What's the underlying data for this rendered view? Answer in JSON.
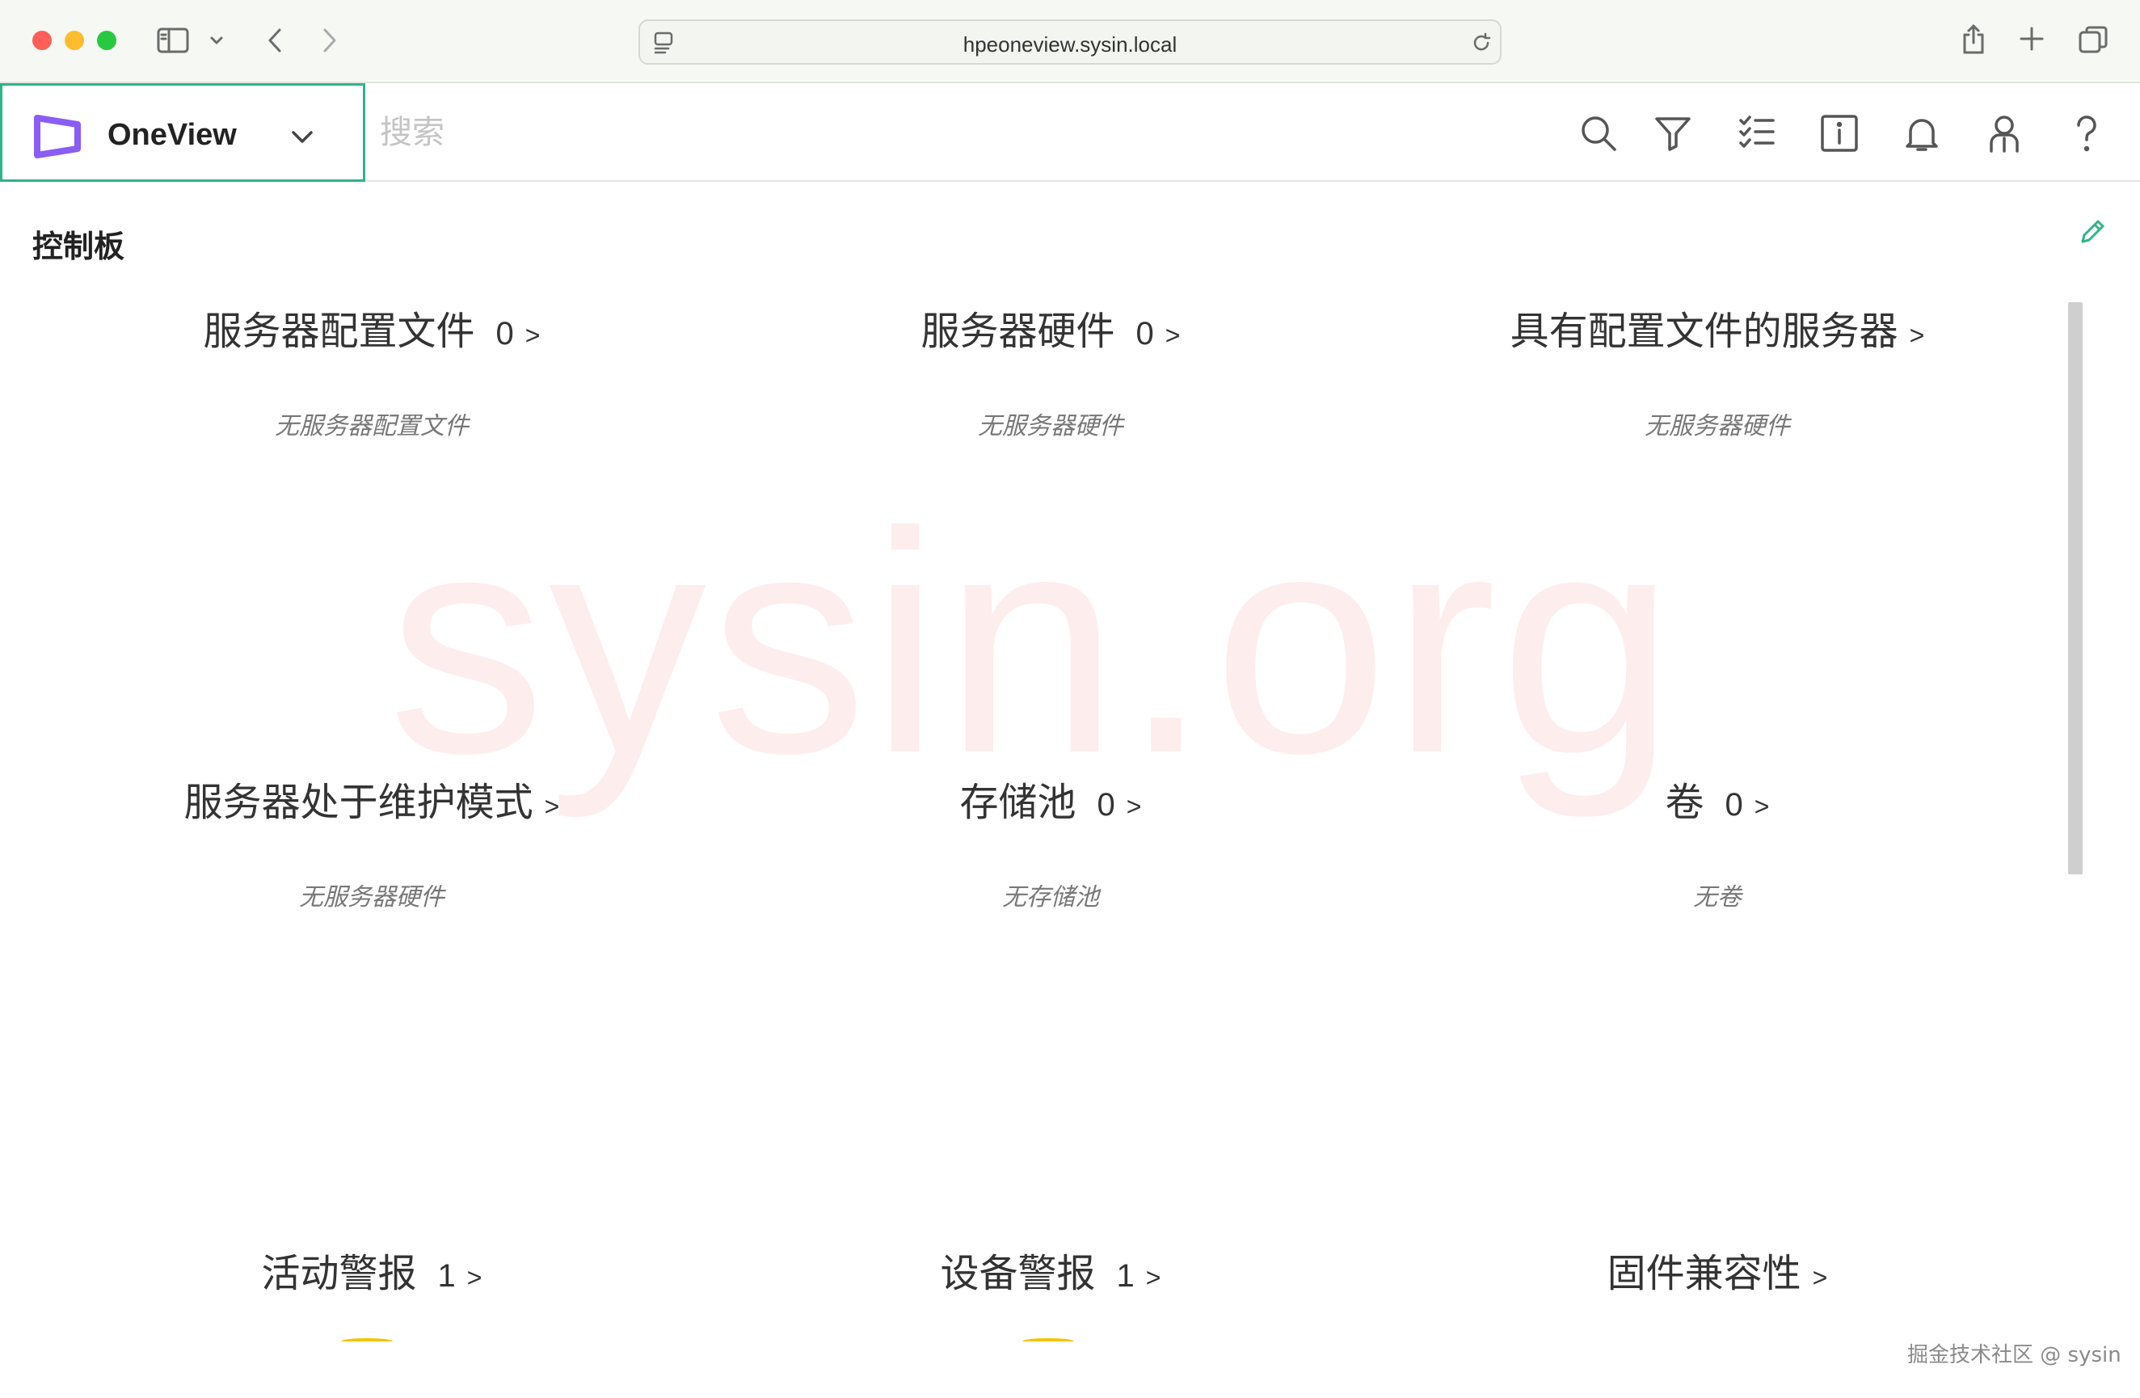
{
  "browser": {
    "url": "hpeoneview.sysin.local"
  },
  "app": {
    "name": "OneView",
    "search_placeholder": "搜索",
    "accent_color": "#2fb38a",
    "logo_color": "#8b5cf6"
  },
  "dashboard": {
    "title": "控制板",
    "panels": [
      {
        "name": "服务器配置文件",
        "count": "0",
        "arrow": ">",
        "empty": "无服务器配置文件"
      },
      {
        "name": "服务器硬件",
        "count": "0",
        "arrow": ">",
        "empty": "无服务器硬件"
      },
      {
        "name": "具有配置文件的服务器",
        "count": "",
        "arrow": ">",
        "empty": "无服务器硬件"
      },
      {
        "name": "服务器处于维护模式",
        "count": "",
        "arrow": ">",
        "empty": "无服务器硬件"
      },
      {
        "name": "存储池",
        "count": "0",
        "arrow": ">",
        "empty": "无存储池"
      },
      {
        "name": "卷",
        "count": "0",
        "arrow": ">",
        "empty": "无卷"
      },
      {
        "name": "活动警报",
        "count": "1",
        "arrow": ">",
        "empty": ""
      },
      {
        "name": "设备警报",
        "count": "1",
        "arrow": ">",
        "empty": ""
      },
      {
        "name": "固件兼容性",
        "count": "",
        "arrow": ">",
        "empty": ""
      }
    ]
  },
  "watermark": "sysin.org",
  "credit": "掘金技术社区 @ sysin"
}
